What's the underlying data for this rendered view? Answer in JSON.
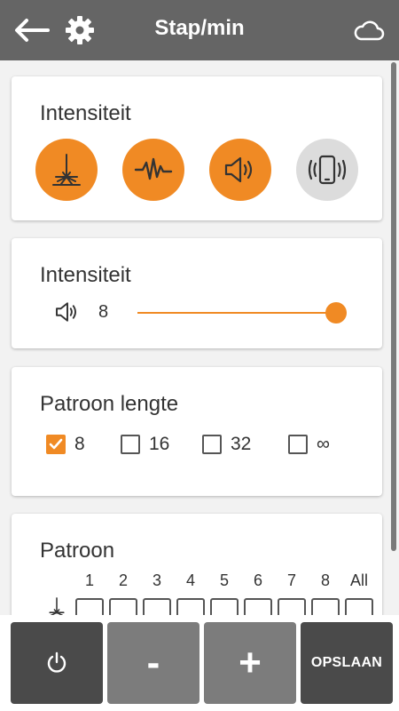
{
  "header": {
    "title": "Stap/min",
    "back_icon": "arrow-left-icon",
    "settings_icon": "gear-icon",
    "cloud_icon": "cloud-icon",
    "background": "#656565"
  },
  "accent_color": "#f08a24",
  "intensity_mode": {
    "title": "Intensiteit",
    "buttons": [
      {
        "icon": "impact-icon",
        "active": true
      },
      {
        "icon": "pulse-wave-icon",
        "active": true
      },
      {
        "icon": "speaker-icon",
        "active": true
      },
      {
        "icon": "phone-vibrate-icon",
        "active": false
      }
    ]
  },
  "intensity_level": {
    "title": "Intensiteit",
    "icon": "speaker-icon",
    "value": "8",
    "slider_fraction": 1.0
  },
  "pattern_length": {
    "title": "Patroon lengte",
    "options": [
      {
        "label": "8",
        "checked": true
      },
      {
        "label": "16",
        "checked": false
      },
      {
        "label": "32",
        "checked": false
      },
      {
        "label": "∞",
        "checked": false
      }
    ]
  },
  "pattern": {
    "title": "Patroon",
    "row_icon": "impact-icon",
    "columns": [
      "1",
      "2",
      "3",
      "4",
      "5",
      "6",
      "7",
      "8",
      "All"
    ]
  },
  "bottom_bar": {
    "power_icon": "power-icon",
    "minus_label": "-",
    "plus_label": "+",
    "save_label": "OPSLAAN"
  }
}
